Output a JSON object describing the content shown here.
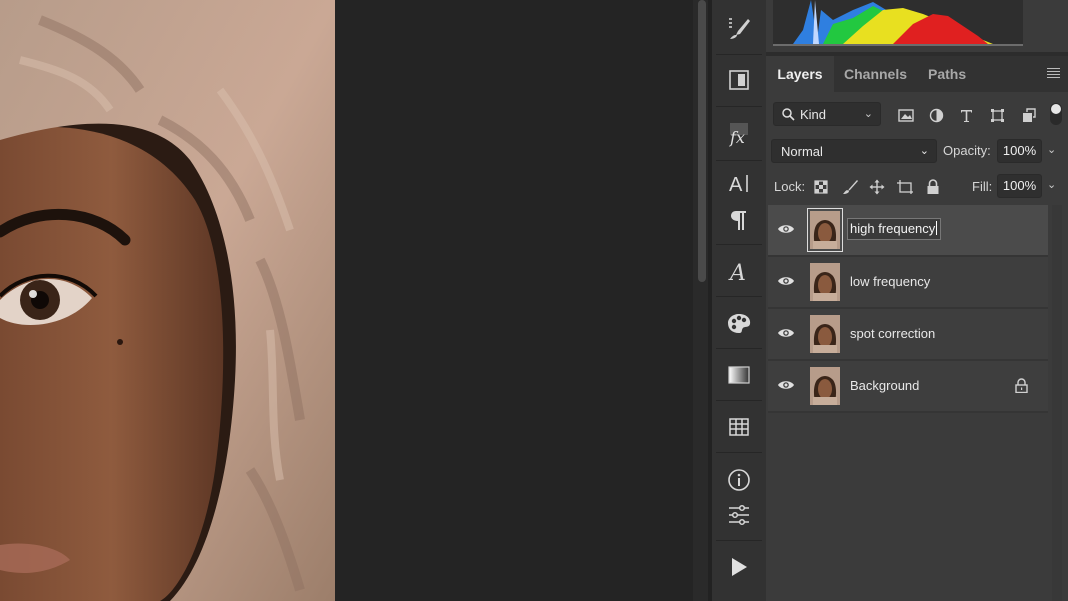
{
  "canvas": {
    "image_subject": "portrait-photo"
  },
  "tools": [
    {
      "name": "brush-settings-icon"
    },
    {
      "name": "clone-source-icon"
    },
    {
      "name": "styles-fx-icon"
    },
    {
      "name": "character-icon"
    },
    {
      "name": "paragraph-icon"
    },
    {
      "name": "glyphs-icon"
    },
    {
      "name": "color-swatches-icon"
    },
    {
      "name": "gradients-icon"
    },
    {
      "name": "table-icon"
    },
    {
      "name": "info-icon"
    },
    {
      "name": "adjustments-icon"
    },
    {
      "name": "actions-play-icon"
    }
  ],
  "panel": {
    "tabs": [
      "Layers",
      "Channels",
      "Paths"
    ],
    "active_tab": "Layers",
    "filter": {
      "kind_label": "Kind"
    },
    "blend_mode": "Normal",
    "opacity_label": "Opacity:",
    "opacity_value": "100%",
    "lock_label": "Lock:",
    "fill_label": "Fill:",
    "fill_value": "100%",
    "layers": [
      {
        "name": "high frequency",
        "visible": true,
        "selected": true,
        "editing": true,
        "locked": false
      },
      {
        "name": "low frequency",
        "visible": true,
        "selected": false,
        "editing": false,
        "locked": false
      },
      {
        "name": "spot correction",
        "visible": true,
        "selected": false,
        "editing": false,
        "locked": false
      },
      {
        "name": "Background",
        "visible": true,
        "selected": false,
        "editing": false,
        "locked": true
      }
    ]
  },
  "colors": {
    "panel_bg": "#3b3b3b",
    "selected_layer_bg": "#4b4b4b",
    "tool_column_bg": "#323232"
  }
}
